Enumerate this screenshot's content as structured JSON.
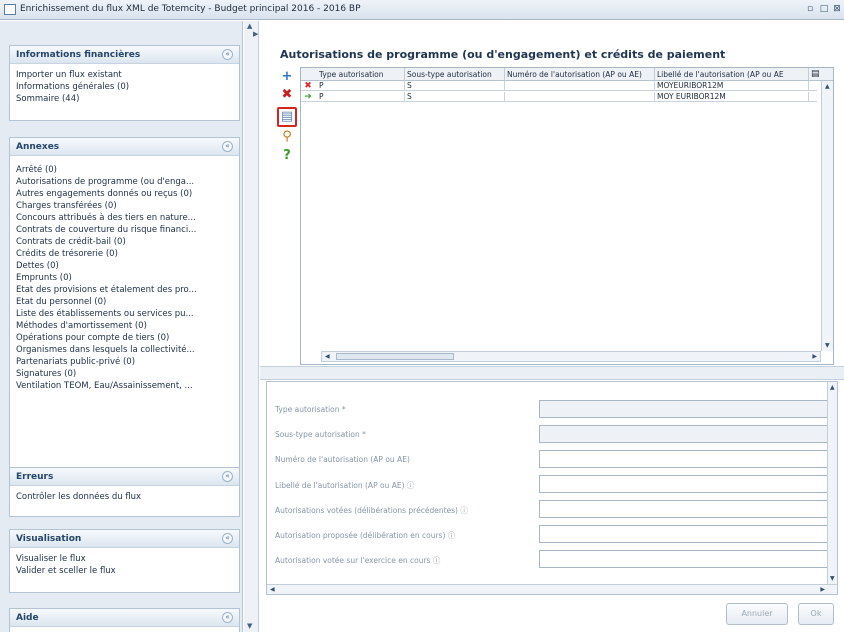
{
  "window": {
    "title": "Enrichissement du flux XML de Totemcity - Budget principal 2016 - 2016 BP",
    "restore_glyph": "▫",
    "maximize_glyph": "□",
    "close_glyph": "⊠"
  },
  "sidebar": {
    "panels": [
      {
        "title": "Informations financières",
        "items": [
          "Importer un flux existant",
          "Informations générales (0)",
          "Sommaire (44)"
        ]
      },
      {
        "title": "Annexes",
        "items": [
          "Arrêté (0)",
          "Autorisations de programme (ou d'enga...",
          "Autres engagements donnés ou reçus (0)",
          "Charges transférées (0)",
          "Concours attribués à des tiers en nature...",
          "Contrats de couverture du risque financi...",
          "Contrats de crédit-bail (0)",
          "Crédits de trésorerie (0)",
          "Dettes (0)",
          "Emprunts (0)",
          "Etat des provisions et étalement des pro...",
          "Etat du personnel (0)",
          "Liste des établissements ou services pu...",
          "Méthodes d'amortissement (0)",
          "Opérations pour compte de tiers (0)",
          "Organismes dans lesquels la collectivité...",
          "Partenariats public-privé (0)",
          "Signatures (0)",
          "Ventilation TEOM, Eau/Assainissement, ..."
        ]
      },
      {
        "title": "Erreurs",
        "items": [
          "Contrôler les données du flux"
        ]
      },
      {
        "title": "Visualisation",
        "items": [
          "Visualiser le flux",
          "Valider et sceller le flux"
        ]
      },
      {
        "title": "Aide",
        "items": []
      }
    ],
    "collapse_glyph": "«"
  },
  "main": {
    "title": "Autorisations de programme (ou d'engagement) et crédits de paiement",
    "toolbar": {
      "add": "+",
      "delete": "✖",
      "save": "▤",
      "search": "⚲",
      "help": "?"
    },
    "table": {
      "columns": [
        "Type autorisation",
        "Sous-type autorisation",
        "Numéro de l'autorisation (AP ou AE)",
        "Libellé de l'autorisation (AP ou AE"
      ],
      "rows": [
        {
          "marker": "✖",
          "marker_color": "#d93030",
          "cells": [
            "P",
            "S",
            "",
            "MOYEURIBOR12M"
          ]
        },
        {
          "marker": "➜",
          "marker_color": "#3aa33a",
          "cells": [
            "P",
            "S",
            "",
            "MOY EURIBOR12M"
          ]
        }
      ]
    },
    "form": {
      "fields": [
        {
          "label": "Type autorisation *",
          "value": ""
        },
        {
          "label": "Sous-type autorisation *",
          "value": ""
        },
        {
          "label": "Numéro de l'autorisation (AP ou AE)",
          "value": ""
        },
        {
          "label": "Libellé de l'autorisation (AP ou AE) ⓘ",
          "value": ""
        },
        {
          "label": "Autorisations votées (délibérations précédentes) ⓘ",
          "value": ""
        },
        {
          "label": "Autorisation proposée (délibération en cours) ⓘ",
          "value": ""
        },
        {
          "label": "Autorisation votée sur l'exercice en cours ⓘ",
          "value": ""
        }
      ]
    },
    "buttons": {
      "cancel": "Annuler",
      "ok": "Ok"
    }
  },
  "colors": {
    "accent": "#25456a",
    "selected_border": "#d42525",
    "add_icon": "#2b73c7",
    "delete_icon": "#c42121",
    "help_icon": "#3a9a2a"
  }
}
